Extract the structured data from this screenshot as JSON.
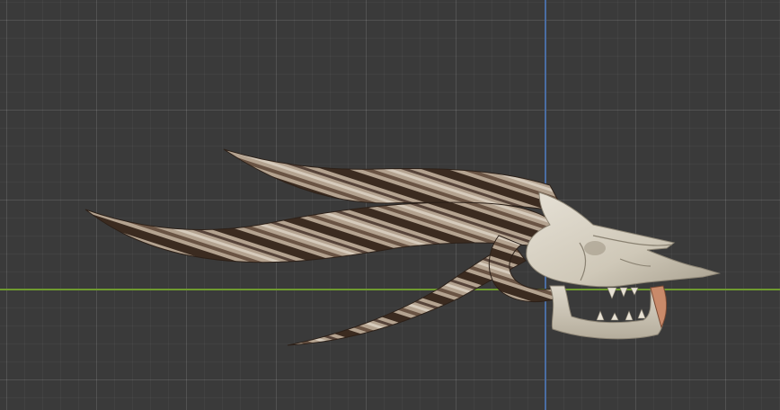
{
  "viewport": {
    "view": "3d-viewport",
    "object": "skull-with-horns-model"
  },
  "colors": {
    "background": "#3a3a3a",
    "grid_major": "#4c4c4c",
    "grid_minor": "#424242",
    "x_axis": "#6f9a2f",
    "y_axis": "#4a6da3",
    "horn_light": "#b9a896",
    "horn_dark": "#3a2a1f",
    "bone": "#d8d3c6"
  }
}
